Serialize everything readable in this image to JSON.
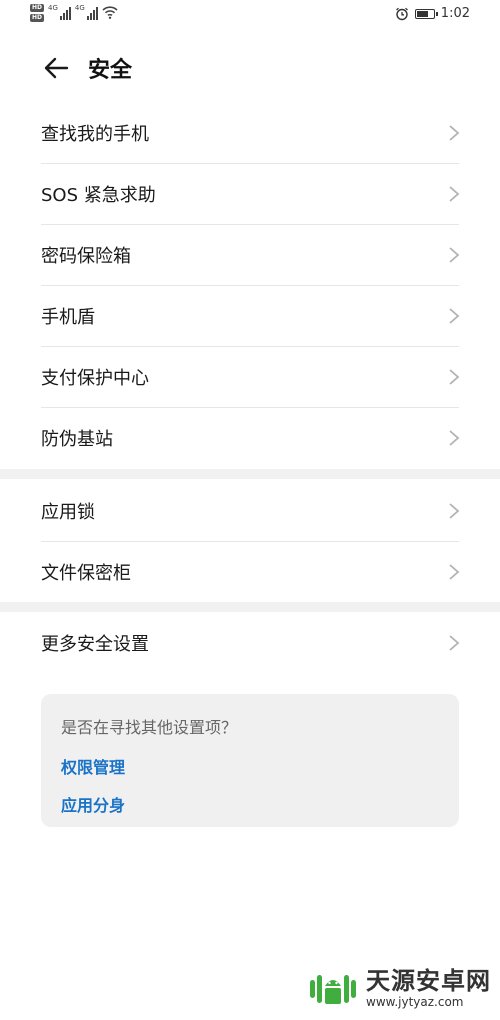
{
  "status_bar": {
    "hd_label": "HD",
    "network_type_1": "4G",
    "network_type_2": "4G",
    "time": "1:02",
    "battery_level": 0.8
  },
  "header": {
    "title": "安全"
  },
  "groups": [
    {
      "items": [
        {
          "label": "查找我的手机"
        },
        {
          "label": "SOS 紧急求助"
        },
        {
          "label": "密码保险箱"
        },
        {
          "label": "手机盾"
        },
        {
          "label": "支付保护中心"
        },
        {
          "label": "防伪基站"
        }
      ]
    },
    {
      "items": [
        {
          "label": "应用锁"
        },
        {
          "label": "文件保密柜"
        }
      ]
    },
    {
      "items": [
        {
          "label": "更多安全设置"
        }
      ]
    }
  ],
  "suggestions": {
    "question": "是否在寻找其他设置项？",
    "links": [
      "权限管理",
      "应用分身"
    ]
  },
  "watermark": {
    "name": "天源安卓网",
    "url": "www.jytyaz.com"
  },
  "colors": {
    "link": "#1a73c7",
    "divider": "#e6e6e6",
    "group_gap": "#f1f1f1",
    "card_bg": "#f0f0f0",
    "watermark_green": "#3fae3f"
  },
  "icons": {
    "back": "arrow-left-icon",
    "chevron": "chevron-right-icon",
    "alarm": "alarm-clock-icon",
    "wifi": "wifi-icon",
    "battery": "battery-icon"
  }
}
